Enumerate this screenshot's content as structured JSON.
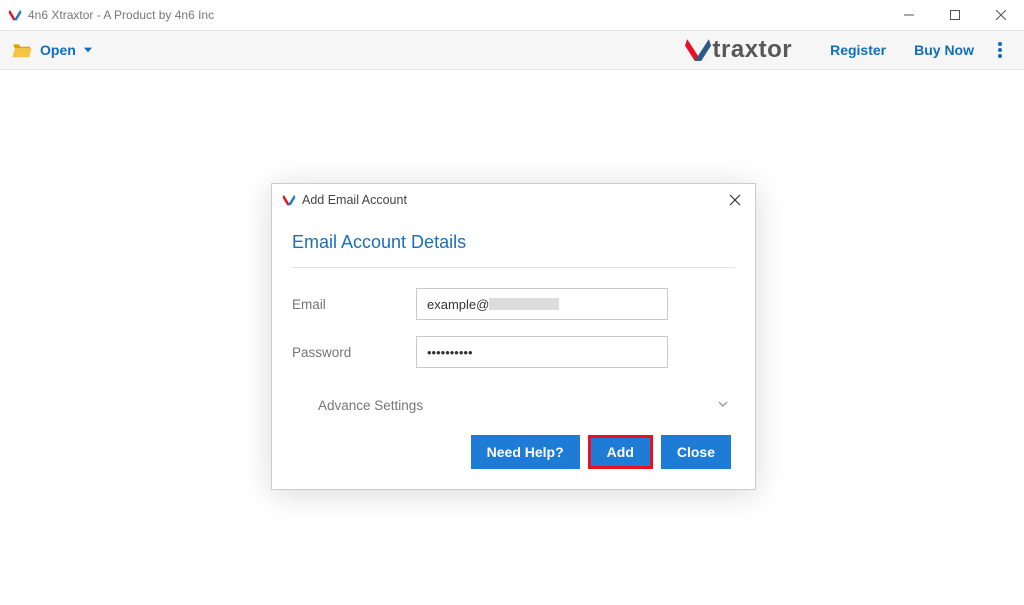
{
  "window": {
    "title": "4n6 Xtraxtor - A Product by 4n6 Inc"
  },
  "toolbar": {
    "open_label": "Open",
    "register_label": "Register",
    "buy_label": "Buy Now"
  },
  "brand": {
    "name": "traxtor"
  },
  "dialog": {
    "title": "Add Email Account",
    "heading": "Email Account Details",
    "email_label": "Email",
    "email_value": "example@",
    "password_label": "Password",
    "password_value": "••••••••••",
    "advance_label": "Advance Settings",
    "need_help_label": "Need Help?",
    "add_label": "Add",
    "close_label": "Close"
  }
}
